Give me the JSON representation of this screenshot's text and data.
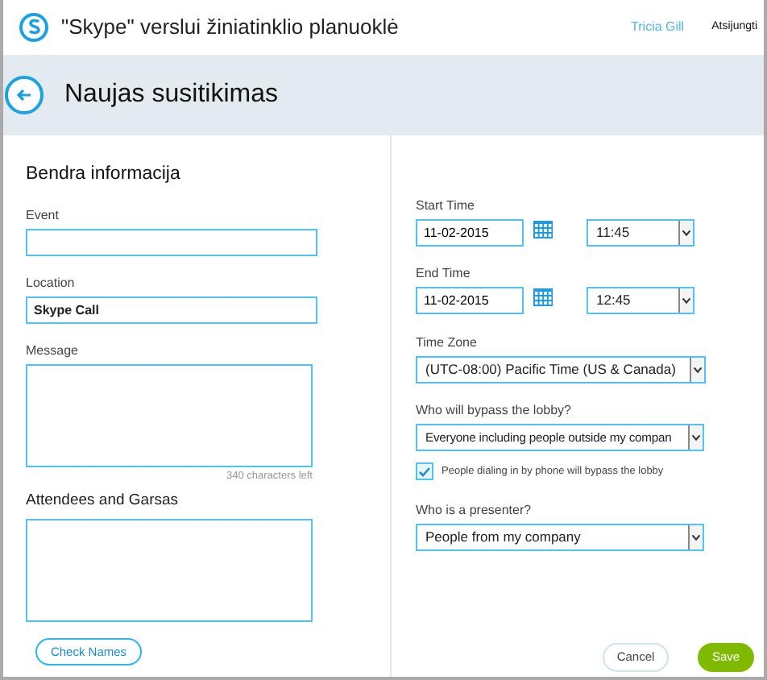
{
  "header": {
    "title": "\"Skype\" verslui žiniatinklio planuoklė",
    "user": "Tricia Gill",
    "sign_out": "Atsijungti"
  },
  "page_title": "Naujas susitikimas",
  "section_title": "Bendra informacija",
  "left": {
    "event": {
      "label": "Event"
    },
    "location": {
      "label": "Location",
      "value": "Skype Call"
    },
    "message": {
      "label": "Message",
      "counter": "340 characters left"
    },
    "attendees": {
      "label": "Attendees and Garsas"
    },
    "check_names": "Check Names"
  },
  "start": {
    "label": "Start Time",
    "date": "11-02-2015",
    "time": "11:45"
  },
  "end": {
    "label": "End Time",
    "date": "11-02-2015",
    "time": "12:45"
  },
  "time_zone": {
    "label": "Time Zone",
    "value": "(UTC-08:00) Pacific Time (US & Canada)"
  },
  "lobby": {
    "label": "Who will bypass the lobby?",
    "value": "Everyone including people outside my compan"
  },
  "phone_bypass": {
    "label": "People dialing in by phone will bypass the lobby",
    "checked": true
  },
  "presenter": {
    "label": "Who is a presenter?",
    "value": "People from my company"
  },
  "buttons": {
    "cancel": "Cancel",
    "save": "Save"
  }
}
